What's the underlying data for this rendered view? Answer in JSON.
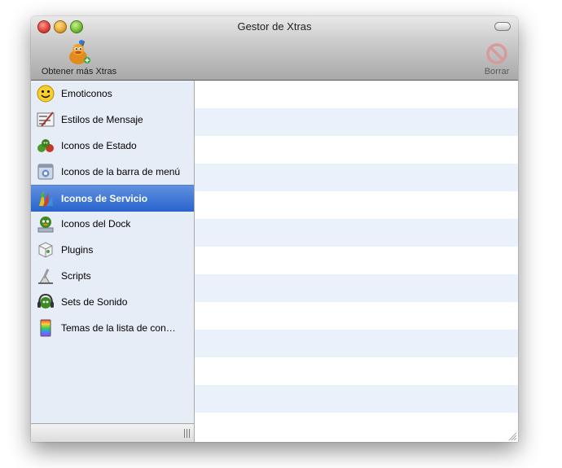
{
  "window": {
    "title": "Gestor de Xtras"
  },
  "toolbar": {
    "get_more_label": "Obtener más Xtras",
    "get_more_icon": "adium-duck-icon",
    "delete_label": "Borrar",
    "delete_icon": "no-entry-icon"
  },
  "sidebar": {
    "selected_index": 4,
    "items": [
      {
        "label": "Emoticonos",
        "icon": "smiley-icon"
      },
      {
        "label": "Estilos de Mensaje",
        "icon": "message-style-icon"
      },
      {
        "label": "Iconos de Estado",
        "icon": "status-icons-icon"
      },
      {
        "label": "Iconos de la barra de menú",
        "icon": "menubar-icon"
      },
      {
        "label": "Iconos de Servicio",
        "icon": "service-icons-icon"
      },
      {
        "label": "Iconos del Dock",
        "icon": "dock-icon"
      },
      {
        "label": "Plugins",
        "icon": "plugin-icon"
      },
      {
        "label": "Scripts",
        "icon": "script-icon"
      },
      {
        "label": "Sets de Sonido",
        "icon": "headphones-icon"
      },
      {
        "label": "Temas de la lista de con…",
        "icon": "contact-list-theme-icon"
      }
    ]
  },
  "colors": {
    "selection": "#2963cc",
    "sidebar_bg": "#e6edf6",
    "stripe": "#ebf1fb"
  }
}
